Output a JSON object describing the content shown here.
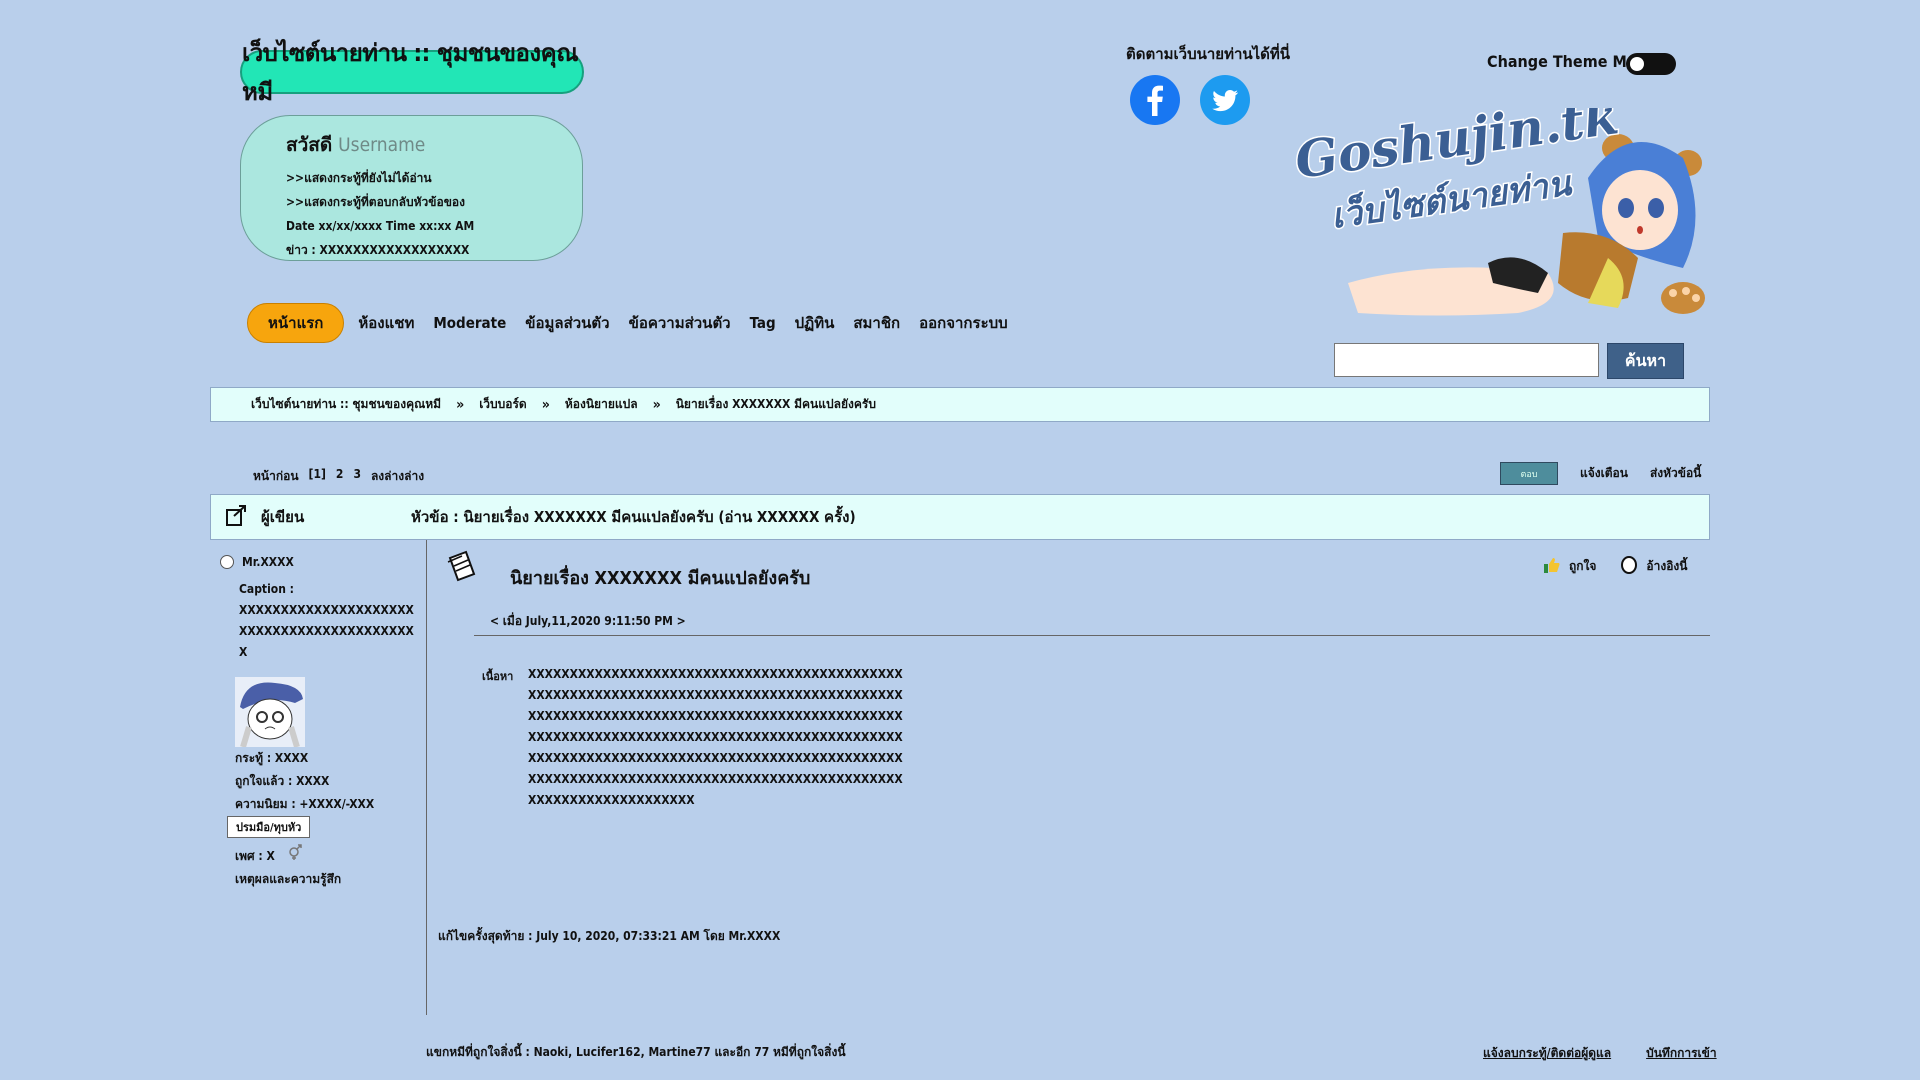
{
  "header": {
    "site_title": "เว็บไซต์นายท่าน :: ชุมชนของคุณหมี",
    "welcome": {
      "greeting": "สวัสดี",
      "username": "Username",
      "link_unread": ">>แสดงกระทู้ที่ยังไม่ได้อ่าน",
      "link_replies": ">>แสดงกระทู้ที่ตอบกลับหัวข้อของ",
      "datetime": "Date xx/xx/xxxx Time xx:xx AM",
      "news": "ข่าว : XXXXXXXXXXXXXXXXXX"
    },
    "follow_label": "ติดตามเว็บนายท่านได้ที่นี่",
    "social": [
      "facebook-icon",
      "twitter-icon"
    ],
    "theme_label": "Change Theme Mode",
    "logo_text_main": "Goshujin.tk",
    "logo_text_sub": "เว็บไซต์นายท่าน"
  },
  "nav": {
    "items": [
      "หน้าแรก",
      "ห้องแชท",
      "Moderate",
      "ข้อมูลส่วนตัว",
      "ข้อความส่วนตัว",
      "Tag",
      "ปฏิทิน",
      "สมาชิก",
      "ออกจากระบบ"
    ],
    "active_color": "#f7a50d"
  },
  "search": {
    "button": "ค้นหา",
    "value": ""
  },
  "breadcrumb": [
    "เว็บไซต์นายท่าน :: ชุมชนของคุณหมี",
    "เว็บบอร์ด",
    "ห้องนิยายแปล",
    "นิยายเรื่อง XXXXXXX มีคนแปลยังครับ"
  ],
  "pager": {
    "prev": "หน้าก่อน",
    "pages": [
      "[1]",
      "2",
      "3"
    ],
    "to_bottom": "ลงล่างล่าง"
  },
  "top_actions": {
    "reply": "ตอบ",
    "notify": "แจ้งเตือน",
    "send": "ส่งหัวข้อนี้"
  },
  "thread_header": {
    "author_label": "ผู้เขียน",
    "subject": "หัวข้อ : นิยายเรื่อง XXXXXXX มีคนแปลยังครับ (อ่าน XXXXXX ครั้ง)"
  },
  "poster": {
    "name": "Mr.XXXX",
    "caption_label": "Caption :",
    "caption": "XXXXXXXXXXXXXXXXXXXXXXXXXXXXXXXXXXXXXXXXXXX",
    "stat_posts": "กระทู้ : XXXX",
    "stat_likes": "ถูกใจแล้ว : XXXX",
    "stat_fame": "ความนิยม : +XXXX/-XXX",
    "rank": "ปรมมือ/ทุบหัว",
    "gender": "เพศ : X",
    "mood": "เหตุผลและความรู้สึก"
  },
  "post": {
    "title": "นิยายเรื่อง XXXXXXX มีคนแปลยังครับ",
    "date": "< เมื่อ July,11,2020 9:11:50 PM >",
    "like": "ถูกใจ",
    "quote": "อ้างอิงนี้",
    "body_label": "เนื้อหา",
    "body": "XXXXXXXXXXXXXXXXXXXXXXXXXXXXXXXXXXXXXXXXXXXXXXXXXXXXXXXXXXXXXXXXXXXXXXXXXXXXXXXXXXXXXXXXXXXXXXXXXXXXXXXXXXXXXXXXXXXXXXXXXXXXXXXXXXXXXXXXXXXXXXXXXXXXXXXXXXXXXXXXXXXXXXXXXXXXXXXXXXXXXXXXXXXXXXXXXXXXXXXXXXXXXXXXXXXXXXXXXXXXXXXXXXXXXXXXXXXXXXXXXXXXXXXXXXXXXXXXXXXXXXXXXXXXXXXXXXXXXXXXXXXXXXXXXX",
    "edited": "แก้ไขครั้งสุดท้าย : July 10, 2020, 07:33:21 AM โดย Mr.XXXX"
  },
  "footer": {
    "online": "แขกหมีที่ถูกใจสิ่งนี้ : Naoki, Lucifer162, Martine77 และอีก 77 หมีที่ถูกใจสิ่งนี้",
    "report": "แจ้งลบกระทู้/ติดต่อผู้ดูแล",
    "history": "บันทึกการเข้า"
  },
  "colors": {
    "background": "#b9cfeb",
    "title_bg": "#22e6b6",
    "welcome_bg": "#abe7df",
    "bar_bg": "#e2fefb",
    "search_btn": "#3f6189"
  }
}
